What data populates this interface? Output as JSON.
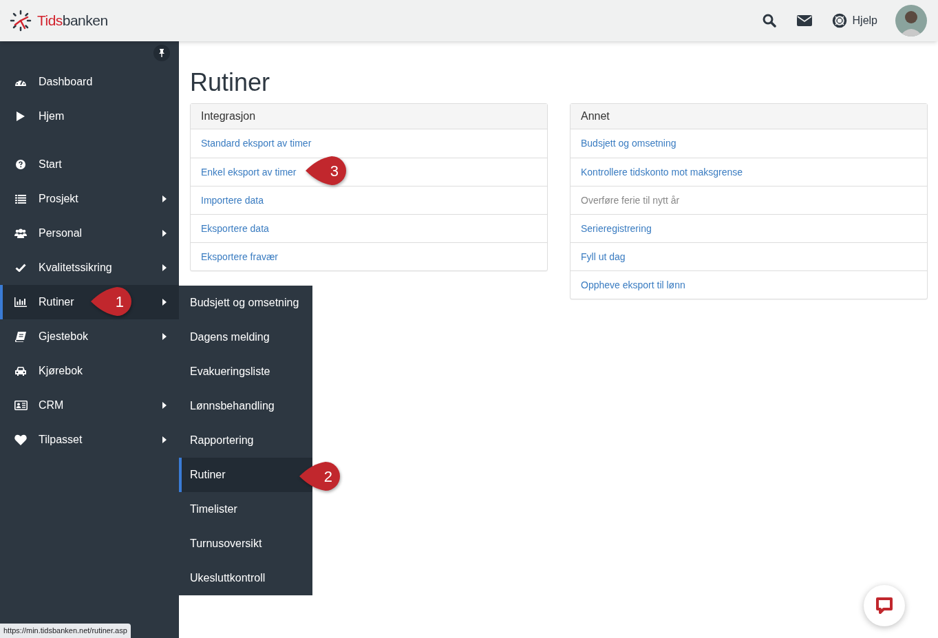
{
  "header": {
    "logo": [
      "Tids",
      "banken"
    ],
    "help": "Hjelp"
  },
  "sidebar": {
    "top_items": [
      {
        "label": "Dashboard",
        "submenu": false,
        "selected": false
      },
      {
        "label": "Hjem",
        "submenu": false,
        "selected": false
      }
    ],
    "items": [
      {
        "label": "Start",
        "submenu": false,
        "selected": false
      },
      {
        "label": "Prosjekt",
        "submenu": true,
        "selected": false
      },
      {
        "label": "Personal",
        "submenu": true,
        "selected": false
      },
      {
        "label": "Kvalitetssikring",
        "submenu": true,
        "selected": false
      },
      {
        "label": "Rutiner",
        "submenu": true,
        "selected": true
      },
      {
        "label": "Gjestebok",
        "submenu": true,
        "selected": false
      },
      {
        "label": "Kjørebok",
        "submenu": false,
        "selected": false
      },
      {
        "label": "CRM",
        "submenu": true,
        "selected": false
      },
      {
        "label": "Tilpasset",
        "submenu": true,
        "selected": false
      }
    ]
  },
  "flyout": [
    {
      "label": "Budsjett og omsetning",
      "selected": false
    },
    {
      "label": "Dagens melding",
      "selected": false
    },
    {
      "label": "Evakueringsliste",
      "selected": false
    },
    {
      "label": "Lønnsbehandling",
      "selected": false
    },
    {
      "label": "Rapportering",
      "selected": false
    },
    {
      "label": "Rutiner",
      "selected": true
    },
    {
      "label": "Timelister",
      "selected": false
    },
    {
      "label": "Turnusoversikt",
      "selected": false
    },
    {
      "label": "Ukesluttkontroll",
      "selected": false
    }
  ],
  "page_title": "Rutiner",
  "panels": [
    {
      "title": "Integrasjon",
      "links": [
        {
          "label": "Standard eksport av timer",
          "disabled": false
        },
        {
          "label": "Enkel eksport av timer",
          "disabled": false
        },
        {
          "label": "Importere data",
          "disabled": false
        },
        {
          "label": "Eksportere data",
          "disabled": false
        },
        {
          "label": "Eksportere fravær",
          "disabled": false
        }
      ]
    },
    {
      "title": "Annet",
      "links": [
        {
          "label": "Budsjett og omsetning",
          "disabled": false
        },
        {
          "label": "Kontrollere tidskonto mot maksgrense",
          "disabled": false
        },
        {
          "label": "Overføre ferie til nytt år",
          "disabled": true
        },
        {
          "label": "Serieregistrering",
          "disabled": false
        },
        {
          "label": "Fyll ut dag",
          "disabled": false
        },
        {
          "label": "Oppheve eksport til lønn",
          "disabled": false
        }
      ]
    }
  ],
  "callouts": [
    {
      "label": "1"
    },
    {
      "label": "2"
    },
    {
      "label": "3"
    }
  ],
  "status_bar": "https://min.tidsbanken.net/rutiner.asp"
}
